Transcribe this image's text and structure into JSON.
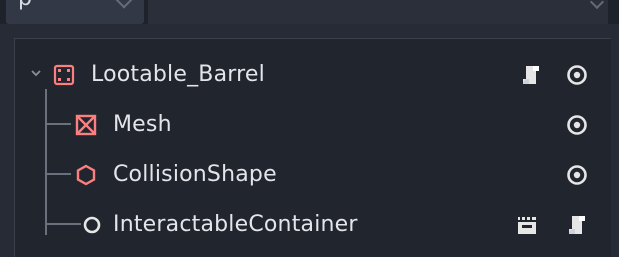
{
  "panel_tab": {
    "label": "p"
  },
  "tree": {
    "nodes": [
      {
        "label": "Lootable_Barrel",
        "icon": "spatial-node-icon",
        "icon_color": "#fc7f7f",
        "expanded": true,
        "right_icons": [
          "script-icon",
          "visibility-eye-icon"
        ]
      },
      {
        "label": "Mesh",
        "icon": "mesh-instance-icon",
        "icon_color": "#fc7f7f",
        "right_icons": [
          "visibility-eye-icon"
        ]
      },
      {
        "label": "CollisionShape",
        "icon": "collision-shape-icon",
        "icon_color": "#fc7f7f",
        "right_icons": [
          "visibility-eye-icon"
        ]
      },
      {
        "label": "InteractableContainer",
        "icon": "node-circle-icon",
        "icon_color": "#e0e0e0",
        "right_icons": [
          "scene-instance-icon",
          "script-icon"
        ]
      }
    ]
  },
  "colors": {
    "accent_node": "#fc7f7f",
    "text": "#e3e5ea",
    "background": "#21252e"
  }
}
